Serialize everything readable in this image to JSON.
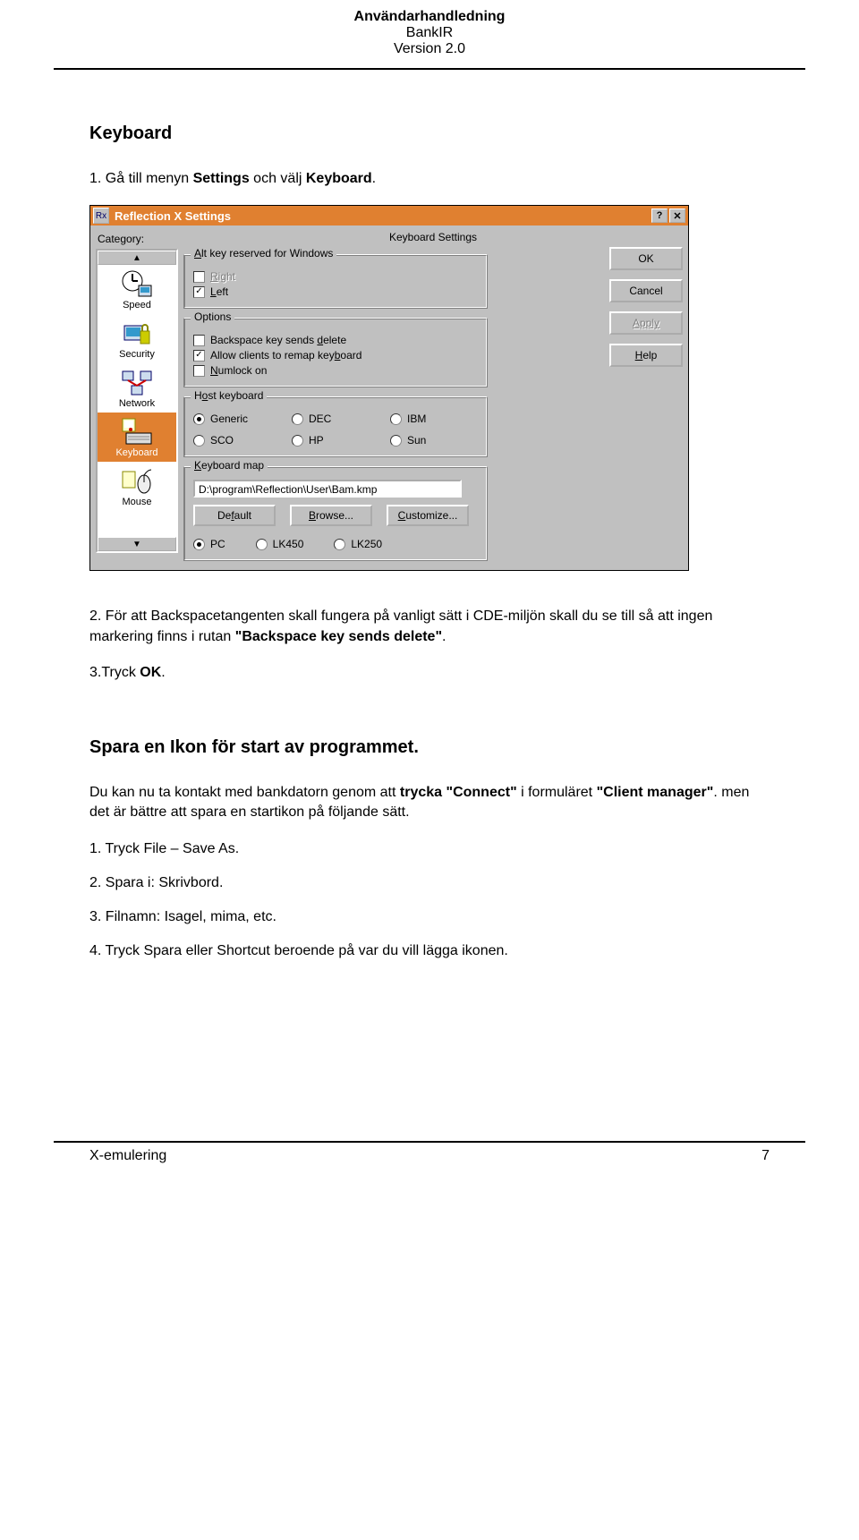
{
  "header": {
    "title_bold": "Användarhandledning",
    "subtitle1": "BankIR",
    "subtitle2": "Version 2.0"
  },
  "section1": {
    "heading": "Keyboard",
    "step1_pre": "1. Gå till menyn ",
    "step1_b1": "Settings",
    "step1_mid": " och välj ",
    "step1_b2": "Keyboard",
    "step1_post": "."
  },
  "dialog": {
    "title": "Reflection X Settings",
    "category_label": "Category:",
    "panel_title": "Keyboard Settings",
    "sidebar_items": [
      "Speed",
      "Security",
      "Network",
      "Keyboard",
      "Mouse"
    ],
    "buttons": {
      "ok": "OK",
      "cancel": "Cancel",
      "apply": "Apply",
      "help": "Help"
    },
    "group_alt": {
      "legend_pre": "",
      "legend_ul": "A",
      "legend_post": "lt key reserved for Windows",
      "right_ul": "R",
      "right_post": "ight",
      "left_ul": "L",
      "left_post": "eft"
    },
    "group_opt": {
      "legend": "Options",
      "bks_pre": "Backspace key sends ",
      "bks_ul": "d",
      "bks_post": "elete",
      "remap_pre": "Allow clients to remap key",
      "remap_ul": "b",
      "remap_post": "oard",
      "num_ul": "N",
      "num_post": "umlock on"
    },
    "group_host": {
      "legend_pre": "H",
      "legend_ul": "o",
      "legend_post": "st keyboard",
      "opts": [
        "Generic",
        "DEC",
        "IBM",
        "SCO",
        "HP",
        "Sun"
      ]
    },
    "group_kmap": {
      "legend_ul": "K",
      "legend_post": "eyboard map",
      "path": "D:\\program\\Reflection\\User\\Bam.kmp",
      "btn_default": "Default",
      "btn_default_ul": "f",
      "btn_browse_ul": "B",
      "btn_browse_post": "rowse...",
      "btn_custom_ul": "C",
      "btn_custom_post": "ustomize...",
      "radios": [
        "PC",
        "LK450",
        "LK250"
      ]
    }
  },
  "section2": {
    "step2_pre": "2. För att Backspacetangenten skall fungera på vanligt sätt i CDE-miljön skall du se till så att ingen markering finns i rutan ",
    "step2_b": "\"Backspace key sends delete\"",
    "step2_post": ".",
    "step3_pre": "3.Tryck ",
    "step3_b": "OK",
    "step3_post": "."
  },
  "section3": {
    "heading": "Spara en Ikon för start av programmet.",
    "para_pre": "Du kan nu ta kontakt med bankdatorn genom att ",
    "para_b1": "trycka \"Connect\"",
    "para_mid": " i formuläret ",
    "para_b2": "\"Client manager\"",
    "para_post": ". men det är bättre att spara en startikon på följande sätt.",
    "steps": {
      "s1_pre": "1. Tryck ",
      "s1_b": "File – Save As.",
      "s2_pre": "2. Spara i: ",
      "s2_b": "Skrivbord.",
      "s3_pre": "3. Filnamn: ",
      "s3_b": "Isagel, mima, etc.",
      "s4_pre": "4. Tryck ",
      "s4_b1": "Spara",
      "s4_mid": " eller ",
      "s4_b2": "Shortcut",
      "s4_post": " beroende på var du vill lägga ikonen."
    }
  },
  "footer": {
    "left": "X-emulering",
    "right": "7"
  }
}
